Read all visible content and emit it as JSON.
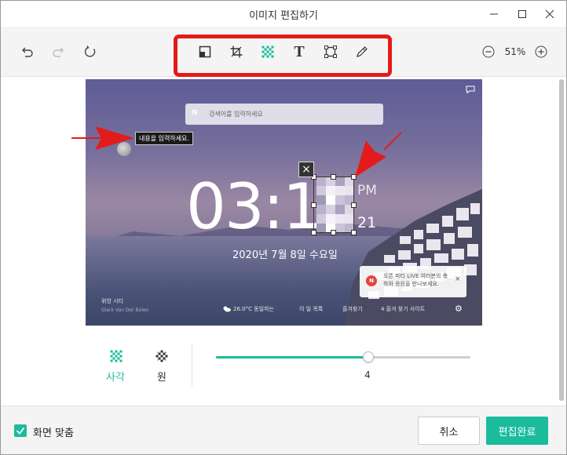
{
  "window": {
    "title": "이미지 편집하기"
  },
  "toolbar": {
    "undo_icon": "undo-icon",
    "redo_icon": "redo-icon",
    "reset_icon": "reset-icon",
    "tools": [
      {
        "name": "background-fill",
        "icon": "fill-square-icon"
      },
      {
        "name": "crop",
        "icon": "crop-icon"
      },
      {
        "name": "mosaic",
        "icon": "mosaic-icon",
        "active": true
      },
      {
        "name": "text",
        "icon": "text-icon",
        "glyph": "T"
      },
      {
        "name": "frame",
        "icon": "frame-icon"
      },
      {
        "name": "pen",
        "icon": "pen-icon"
      }
    ],
    "zoom": "51%"
  },
  "photo": {
    "search_n": "N",
    "search_placeholder": "검색어를 입력하세요",
    "text_tip": "내용을 입력하세요.",
    "clock_main": "03:1",
    "ampm": "PM",
    "seconds": "21",
    "date": "2020년 7월 8일 수요일",
    "notification_n": "N",
    "notification_text": "오픈 파티 LIVE 여러분의 축하와 응원을 만나보세요.",
    "notification_close": "×",
    "location": "위앙 시티",
    "photographer": "Glark Van Der Bolen",
    "weather": "26.0°C 동일하는",
    "bottom_items": [
      "이 일 목록",
      "즐겨찾기",
      "4 즐겨 찾기 사이트"
    ],
    "close_mark": "×"
  },
  "options": {
    "shape_square_label": "사각",
    "shape_circle_label": "원",
    "slider_value": "4",
    "slider_fraction": 0.6
  },
  "footer": {
    "fit_label": "화면 맞춤",
    "fit_checked": true,
    "cancel_label": "취소",
    "done_label": "편집완료"
  },
  "colors": {
    "accent": "#1abc9c",
    "highlight": "#e41b1b"
  }
}
